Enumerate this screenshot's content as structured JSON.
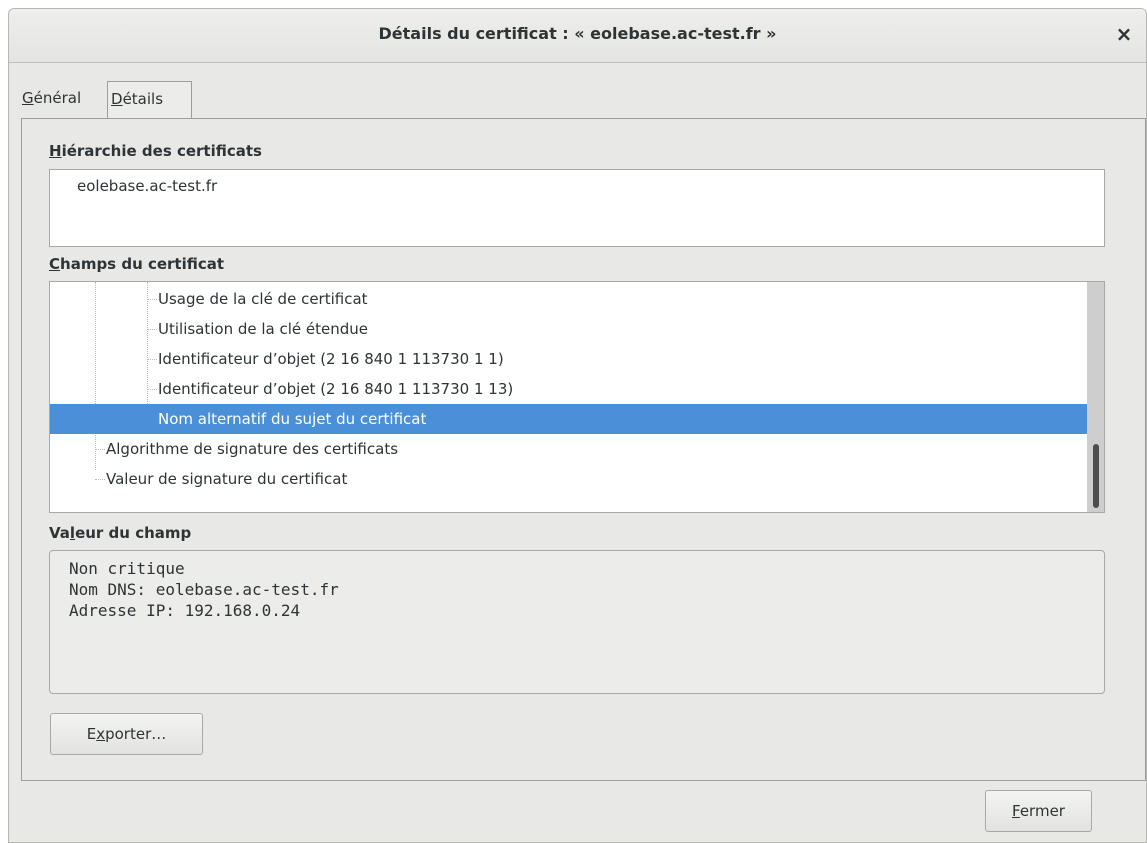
{
  "dialog": {
    "title": "Détails du certificat : « eolebase.ac-test.fr »",
    "close_glyph": "×"
  },
  "tabs": [
    {
      "label_prefix": "",
      "label_mnemonic": "G",
      "label_rest": "énéral"
    },
    {
      "label_prefix": "",
      "label_mnemonic": "D",
      "label_rest": "étails"
    }
  ],
  "hierarchy": {
    "label_mnemonic": "H",
    "label_rest": "iérarchie des certificats",
    "items": [
      "eolebase.ac-test.fr"
    ]
  },
  "fields": {
    "label_mnemonic": "C",
    "label_rest": "hamps du certificat",
    "rows": [
      "Usage de la clé de certificat",
      "Utilisation de la clé étendue",
      "Identificateur d’objet (2 16 840 1 113730 1 1)",
      "Identificateur d’objet (2 16 840 1 113730 1 13)",
      "Nom alternatif du sujet du certificat",
      "Algorithme de signature des certificats",
      "Valeur de signature du certificat"
    ],
    "selected_index": 4
  },
  "field_value": {
    "label_prefix": "Va",
    "label_mnemonic": "l",
    "label_rest": "eur du champ",
    "lines": [
      "Non critique",
      "Nom DNS: eolebase.ac-test.fr",
      "Adresse IP: 192.168.0.24"
    ]
  },
  "buttons": {
    "export_prefix": "E",
    "export_mnemonic": "x",
    "export_rest": "porter…",
    "close_mnemonic": "F",
    "close_rest": "ermer"
  },
  "colors": {
    "selection": "#4a90d9",
    "window_bg": "#e8e8e7"
  }
}
